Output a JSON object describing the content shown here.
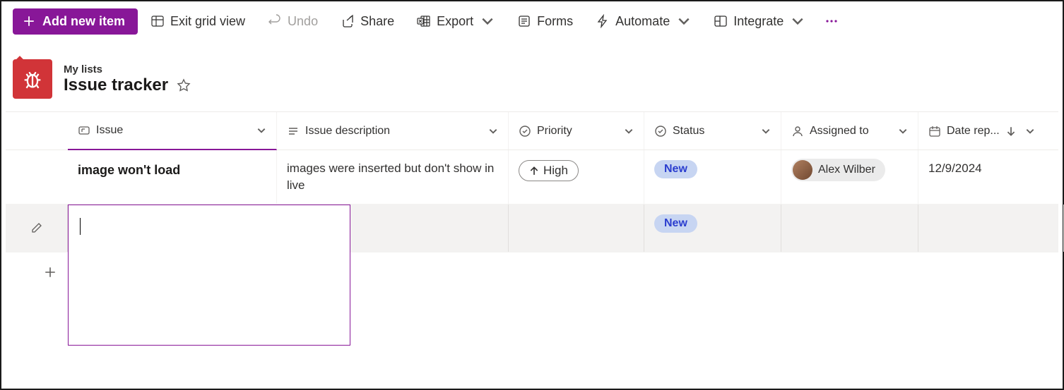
{
  "toolbar": {
    "add": "Add new item",
    "exit": "Exit grid view",
    "undo": "Undo",
    "share": "Share",
    "export": "Export",
    "forms": "Forms",
    "automate": "Automate",
    "integrate": "Integrate"
  },
  "header": {
    "breadcrumb": "My lists",
    "title": "Issue tracker"
  },
  "columns": {
    "issue": "Issue",
    "desc": "Issue description",
    "priority": "Priority",
    "status": "Status",
    "assigned": "Assigned to",
    "date": "Date rep..."
  },
  "rows": [
    {
      "issue": "image won't load",
      "desc": "images were inserted but don't show in live",
      "priority": "High",
      "status": "New",
      "assigned": "Alex Wilber",
      "date": "12/9/2024"
    },
    {
      "issue": "",
      "desc": "",
      "priority": "",
      "status": "New",
      "assigned": "",
      "date": ""
    }
  ]
}
